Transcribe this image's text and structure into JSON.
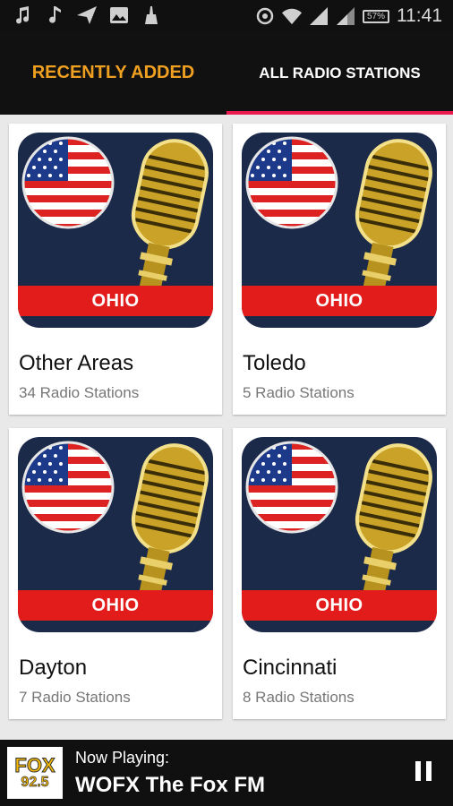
{
  "status_bar": {
    "left_icons": [
      "music-note-icon",
      "music-note-icon",
      "send-icon",
      "image-icon",
      "cleaner-icon"
    ],
    "right_icons": [
      "sync-icon",
      "wifi-icon",
      "signal-icon",
      "signal-icon"
    ],
    "battery": "57%",
    "time": "11:41"
  },
  "tabs": [
    {
      "label": "RECENTLY ADDED",
      "active": false
    },
    {
      "label": "ALL RADIO STATIONS",
      "active": true
    }
  ],
  "colors": {
    "accent_tab": "#f0a020",
    "indicator": "#e8194f",
    "band": "#e21b1b",
    "icon_bg": "#1c2a4a"
  },
  "cards": [
    {
      "badge": "OHIO",
      "title": "Other Areas",
      "subtitle": "34 Radio Stations"
    },
    {
      "badge": "OHIO",
      "title": "Toledo",
      "subtitle": "5 Radio Stations"
    },
    {
      "badge": "OHIO",
      "title": "Dayton",
      "subtitle": "7 Radio Stations"
    },
    {
      "badge": "OHIO",
      "title": "Cincinnati",
      "subtitle": "8 Radio Stations"
    }
  ],
  "player": {
    "logo_line1": "FOX",
    "logo_line2": "92.5",
    "label": "Now Playing:",
    "station": "WOFX The Fox FM",
    "control_icon": "pause-icon"
  }
}
